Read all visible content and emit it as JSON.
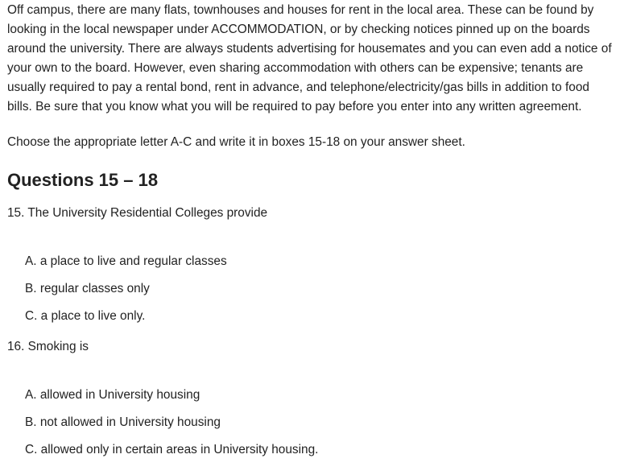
{
  "intro": "Off campus, there are many flats, townhouses and houses for rent in the local area. These can be found by looking in the local newspaper under ACCOMMODATION, or by checking notices pinned up on the boards around the university. There are always students advertising for housemates and you can even add a notice of your own to the board. However, even sharing accommodation with others can be expensive; tenants are usually required to pay a rental bond, rent in advance, and telephone/electricity/gas bills in addition to food bills. Be sure that you know what you will be required to pay before you enter into any written agreement.",
  "instruction": "Choose the appropriate letter A-C and write it in boxes 15-18 on your answer sheet.",
  "heading": "Questions 15 – 18",
  "questions": [
    {
      "text": "15. The University Residential Colleges provide",
      "options": [
        "A. a place to live and regular classes",
        "B. regular classes only",
        "C. a place to live only."
      ]
    },
    {
      "text": "16. Smoking is",
      "options": [
        "A. allowed in University housing",
        "B. not allowed in University housing",
        "C. allowed only in certain areas in University housing."
      ]
    }
  ]
}
